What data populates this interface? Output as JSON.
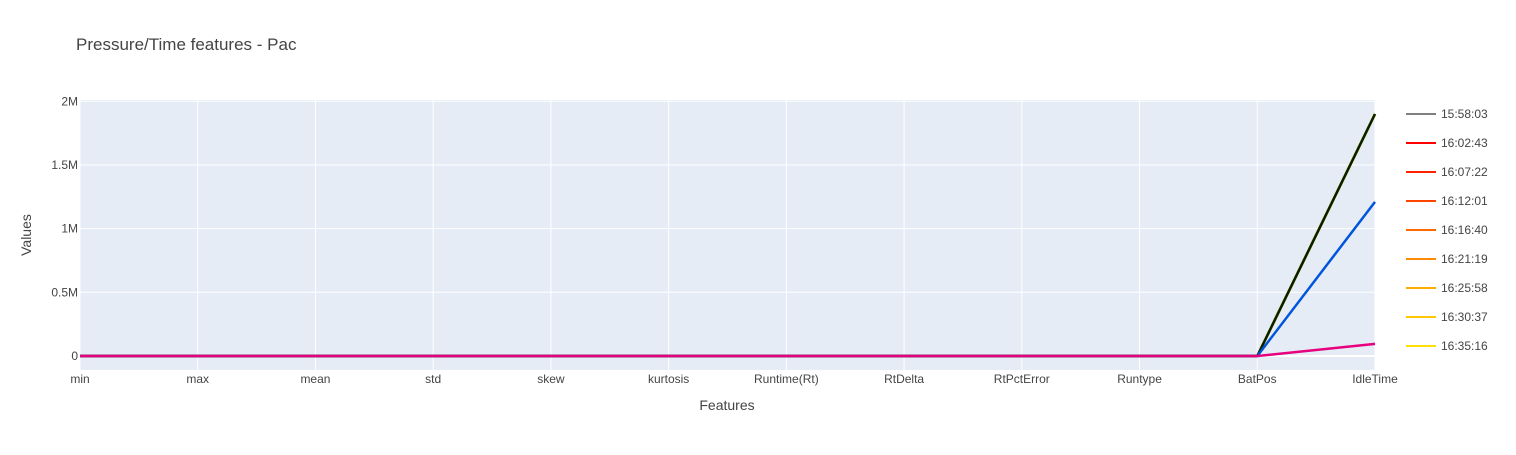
{
  "chart_data": {
    "type": "line",
    "title": "Pressure/Time features - Pac",
    "xlabel": "Features",
    "ylabel": "Values",
    "categories": [
      "min",
      "max",
      "mean",
      "std",
      "skew",
      "kurtosis",
      "Runtime(Rt)",
      "RtDelta",
      "RtPctError",
      "Runtype",
      "BatPos",
      "IdleTime"
    ],
    "ylim": [
      -110000,
      2010000
    ],
    "yticks": [
      {
        "value": 0,
        "label": "0"
      },
      {
        "value": 500000,
        "label": "0.5M"
      },
      {
        "value": 1000000,
        "label": "1M"
      },
      {
        "value": 1500000,
        "label": "1.5M"
      },
      {
        "value": 2000000,
        "label": "2M"
      }
    ],
    "grid": true,
    "legend_position": "right",
    "series": [
      {
        "name": "15:58:03",
        "color": "#808080",
        "values": [
          0,
          0,
          0,
          0,
          0,
          0,
          0,
          0,
          0,
          0,
          0,
          1900000
        ]
      },
      {
        "name": "16:02:43",
        "color": "#ff0000",
        "values": [
          0,
          0,
          0,
          0,
          0,
          0,
          0,
          0,
          0,
          0,
          0,
          1900000
        ]
      },
      {
        "name": "16:07:22",
        "color": "#ff2200",
        "values": [
          0,
          0,
          0,
          0,
          0,
          0,
          0,
          0,
          0,
          0,
          0,
          1900000
        ]
      },
      {
        "name": "16:12:01",
        "color": "#ff4500",
        "values": [
          0,
          0,
          0,
          0,
          0,
          0,
          0,
          0,
          0,
          0,
          0,
          1900000
        ]
      },
      {
        "name": "16:16:40",
        "color": "#ff6a00",
        "values": [
          0,
          0,
          0,
          0,
          0,
          0,
          0,
          0,
          0,
          0,
          0,
          1900000
        ]
      },
      {
        "name": "16:21:19",
        "color": "#ff8c00",
        "values": [
          0,
          0,
          0,
          0,
          0,
          0,
          0,
          0,
          0,
          0,
          0,
          1900000
        ]
      },
      {
        "name": "16:25:58",
        "color": "#ffaa00",
        "values": [
          0,
          0,
          0,
          0,
          0,
          0,
          0,
          0,
          0,
          0,
          0,
          1900000
        ]
      },
      {
        "name": "16:30:37",
        "color": "#ffc800",
        "values": [
          0,
          0,
          0,
          0,
          0,
          0,
          0,
          0,
          0,
          0,
          0,
          1900000
        ]
      },
      {
        "name": "16:35:16",
        "color": "#ffe000",
        "values": [
          0,
          0,
          0,
          0,
          0,
          0,
          0,
          0,
          0,
          0,
          0,
          1900000
        ]
      },
      {
        "color": "#002200",
        "values": [
          0,
          0,
          0,
          0,
          0,
          0,
          0,
          0,
          0,
          0,
          0,
          1900000
        ]
      },
      {
        "color": "#0055dd",
        "values": [
          0,
          0,
          0,
          0,
          0,
          0,
          0,
          0,
          0,
          0,
          0,
          1210000
        ]
      },
      {
        "color": "#e6007e",
        "values": [
          0,
          0,
          0,
          0,
          0,
          0,
          0,
          0,
          0,
          0,
          0,
          95000
        ]
      }
    ]
  }
}
